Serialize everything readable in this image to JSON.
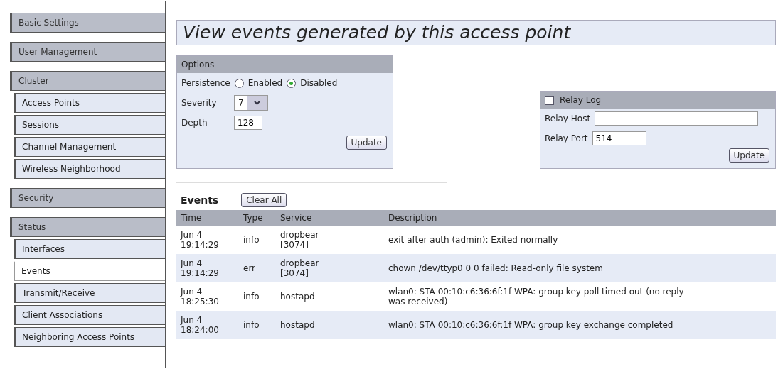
{
  "sidebar": {
    "groups": [
      {
        "label": "Basic Settings",
        "selected": false
      },
      {
        "label": "User Management",
        "selected": false
      },
      {
        "label": "Cluster",
        "selected": false,
        "children": [
          {
            "label": "Access Points",
            "selected": false
          },
          {
            "label": "Sessions",
            "selected": false
          },
          {
            "label": "Channel Management",
            "selected": false
          },
          {
            "label": "Wireless Neighborhood",
            "selected": false
          }
        ]
      },
      {
        "label": "Security",
        "selected": false
      },
      {
        "label": "Status",
        "selected": false,
        "children": [
          {
            "label": "Interfaces",
            "selected": false
          },
          {
            "label": "Events",
            "selected": true
          },
          {
            "label": "Transmit/Receive",
            "selected": false
          },
          {
            "label": "Client Associations",
            "selected": false
          },
          {
            "label": "Neighboring Access Points",
            "selected": false
          }
        ]
      }
    ]
  },
  "page_title": "View events generated by this access point",
  "options": {
    "title": "Options",
    "persistence_label": "Persistence",
    "radios": [
      {
        "label": "Enabled",
        "selected": false
      },
      {
        "label": "Disabled",
        "selected": true
      }
    ],
    "severity_label": "Severity",
    "severity_value": "7",
    "depth_label": "Depth",
    "depth_value": "128",
    "button": "Update"
  },
  "relay": {
    "title": "Relay Log",
    "checked": false,
    "host_label": "Relay Host",
    "port_label": "Relay Port",
    "port_value": "514",
    "button": "Update"
  },
  "events": {
    "title": "Events",
    "clear_button": "Clear All",
    "columns": [
      "Time",
      "Type",
      "Service",
      "Description"
    ],
    "rows": [
      {
        "time": "Jun 4\n19:14:29",
        "type": "info",
        "service": "dropbear\n[3074]",
        "description": "exit after auth (admin): Exited normally"
      },
      {
        "time": "Jun 4\n19:14:29",
        "type": "err",
        "service": "dropbear\n[3074]",
        "description": "chown /dev/ttyp0 0 0 failed: Read-only file system"
      },
      {
        "time": "Jun 4\n18:25:30",
        "type": "info",
        "service": "hostapd",
        "description": "wlan0: STA 00:10:c6:36:6f:1f WPA: group key poll timed out (no reply\nwas received)"
      },
      {
        "time": "Jun 4\n18:24:00",
        "type": "info",
        "service": "hostapd",
        "description": "wlan0: STA 00:10:c6:36:6f:1f WPA: group key exchange completed"
      }
    ]
  }
}
